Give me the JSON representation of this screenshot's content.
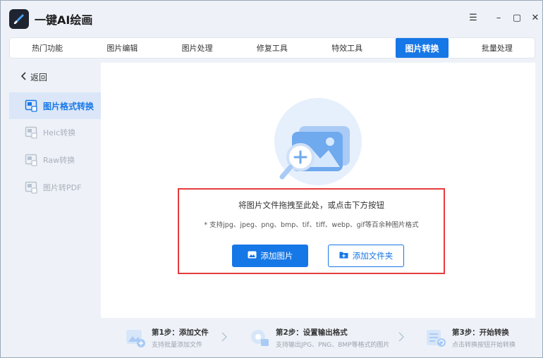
{
  "app": {
    "title": "一键AI绘画",
    "icon": "brush-logo-icon"
  },
  "window_controls": {
    "menu": "☰",
    "minimize": "–",
    "maximize": "▢",
    "close": "✕"
  },
  "tabs": [
    {
      "label": "热门功能"
    },
    {
      "label": "图片编辑"
    },
    {
      "label": "图片处理"
    },
    {
      "label": "修复工具"
    },
    {
      "label": "特效工具"
    },
    {
      "label": "图片转换",
      "active": true
    },
    {
      "label": "批量处理"
    }
  ],
  "sidebar": {
    "back_label": "返回",
    "items": [
      {
        "label": "图片格式转换",
        "active": true
      },
      {
        "label": "Heic转换"
      },
      {
        "label": "Raw转换"
      },
      {
        "label": "图片转PDF"
      }
    ]
  },
  "dropzone": {
    "title": "将图片文件拖拽至此处，或点击下方按钮",
    "subtitle": "* 支持jpg、jpeg、png、bmp、tif、tiff、webp、gif等百余种图片格式",
    "add_image_label": "添加图片",
    "add_folder_label": "添加文件夹"
  },
  "steps": [
    {
      "title": "第1步：添加文件",
      "desc": "支持批量添加文件"
    },
    {
      "title": "第2步：设置输出格式",
      "desc": "支持输出JPG、PNG、BMP等格式的图片"
    },
    {
      "title": "第3步：开始转换",
      "desc": "点击转换按钮开始转换"
    }
  ],
  "colors": {
    "accent": "#1677e6",
    "highlight_border": "#e53c3c"
  }
}
